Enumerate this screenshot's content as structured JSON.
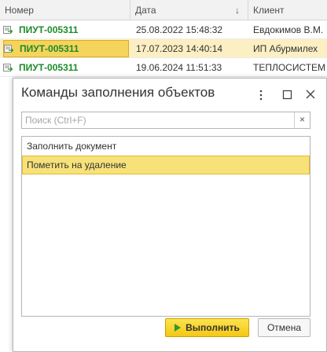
{
  "table": {
    "columns": {
      "number": "Номер",
      "date": "Дата",
      "client": "Клиент"
    },
    "sort_icon": "arrow-down-icon",
    "rows": [
      {
        "number": "ПИУТ-005311",
        "date": "25.08.2022 15:48:32",
        "client": "Евдокимов В.М."
      },
      {
        "number": "ПИУТ-005311",
        "date": "17.07.2023 14:40:14",
        "client": "ИП Абурмилех"
      },
      {
        "number": "ПИУТ-005311",
        "date": "19.06.2024 11:51:33",
        "client": "ТЕПЛОСИСТЕМ"
      }
    ],
    "selected_row": 1,
    "colors": {
      "doc_number": "#1d8a2a",
      "selected_row": "#fbefc3",
      "selected_cell": "#f5d45c"
    }
  },
  "dialog": {
    "title": "Команды заполнения объектов",
    "icons": {
      "more": "more-vertical-icon",
      "maximize": "maximize-icon",
      "close": "close-icon"
    },
    "search": {
      "placeholder": "Поиск (Ctrl+F)",
      "value": "",
      "clear_label": "×"
    },
    "items": [
      {
        "label": "Заполнить документ"
      },
      {
        "label": "Пометить на удаление"
      }
    ],
    "selected_item": 1,
    "buttons": {
      "run_label": "Выполнить",
      "cancel_label": "Отмена"
    },
    "colors": {
      "accent": "#f4c714",
      "selected_item": "#f7e27a",
      "run_icon": "#2e9a2e"
    }
  }
}
